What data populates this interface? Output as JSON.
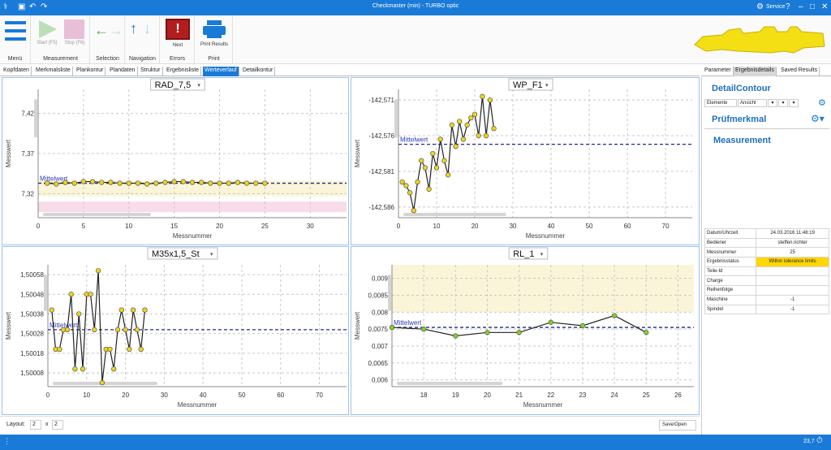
{
  "window": {
    "title": "Checkmaster (min) - TURBO optic",
    "user": "Service"
  },
  "ribbon": {
    "menu_label": "Menü",
    "start_label": "Start (F5)",
    "stop_label": "Stop (F6)",
    "measurement_group": "Measurement",
    "selection_group": "Selection",
    "navigation_group": "Navigation",
    "next_label": "Next",
    "errors_group": "Errors",
    "print_label": "Print Results",
    "print_group": "Print"
  },
  "tabs": [
    "Kopfdaten",
    "Merkmalsliste",
    "Plankontur",
    "Plandaten",
    "Struktur",
    "Ergebnisliste",
    "Werteverlauf",
    "Detailkontur"
  ],
  "right_tabs": [
    "Parameter",
    "Ergebnisdetails",
    "Saved Results"
  ],
  "detail": {
    "contour_title": "DetailContour",
    "toolbar": [
      "Elemente",
      "Ansicht"
    ],
    "pruefmerkmal_title": "Prüfmerkmal",
    "measurement_title": "Measurement",
    "rows": [
      {
        "label": "Datum/Uhrzeit",
        "value": "24.03.2016 11:48:19"
      },
      {
        "label": "Bediener",
        "value": "steffen.richter"
      },
      {
        "label": "Messnummer",
        "value": "25"
      },
      {
        "label": "Ergebnisstatus",
        "value": "Within tolerance limits"
      },
      {
        "label": "Teile-Id",
        "value": ""
      },
      {
        "label": "Charge",
        "value": ""
      },
      {
        "label": "Reihenfolge",
        "value": ""
      },
      {
        "label": "Maschine",
        "value": "-1"
      },
      {
        "label": "Spindel",
        "value": "-1"
      }
    ]
  },
  "bottom": {
    "layout_label": "Layout:",
    "rows": "2",
    "x": "x",
    "cols": "2",
    "save_open": "Save/Open"
  },
  "status": {
    "value": "23,7"
  },
  "colors": {
    "accent": "#1a7ad8",
    "point": "#f2d418",
    "point_green": "#7ed321",
    "mean_line": "#1f2a8c",
    "status_ok": "#ffd700",
    "tol_yellow": "#faf5d8",
    "tol_pink": "#f8dcea"
  },
  "chart_data": [
    {
      "type": "line",
      "title": "RAD_7,5",
      "xlabel": "Messnummer",
      "ylabel": "Messwert",
      "mean_label": "Mittelwert",
      "xlim": [
        0,
        34
      ],
      "ylim": [
        7.29,
        7.45
      ],
      "xticks": [
        0,
        5,
        10,
        15,
        20,
        25,
        30
      ],
      "yticks": [
        7.32,
        7.37,
        7.42
      ],
      "ytick_labels": [
        "7,32",
        "7,37",
        "7,42"
      ],
      "mean": 7.333,
      "bands": [
        {
          "from": 7.317,
          "to": 7.336,
          "color": "tol_yellow"
        },
        {
          "from": 7.297,
          "to": 7.31,
          "color": "tol_pink"
        }
      ],
      "x": [
        1,
        2,
        3,
        4,
        5,
        6,
        7,
        8,
        9,
        10,
        11,
        12,
        13,
        14,
        15,
        16,
        17,
        18,
        19,
        20,
        21,
        22,
        23,
        24,
        25
      ],
      "y": [
        7.333,
        7.332,
        7.334,
        7.333,
        7.335,
        7.335,
        7.334,
        7.334,
        7.333,
        7.333,
        7.333,
        7.332,
        7.333,
        7.334,
        7.335,
        7.335,
        7.334,
        7.334,
        7.333,
        7.333,
        7.333,
        7.334,
        7.333,
        7.333,
        7.333
      ]
    },
    {
      "type": "line",
      "title": "WP_F1",
      "xlabel": "Messnummer",
      "ylabel": "Messwert",
      "mean_label": "Mittelwert",
      "xlim": [
        0,
        77
      ],
      "ylim": [
        -142.5875,
        -142.5695
      ],
      "xticks": [
        0,
        10,
        20,
        30,
        40,
        50,
        60,
        70
      ],
      "yticks": [
        -142.586,
        -142.581,
        -142.576,
        -142.571
      ],
      "ytick_labels": [
        "-142,586",
        "-142,581",
        "-142,576",
        "-142,571"
      ],
      "mean": -142.5772,
      "x": [
        1,
        2,
        3,
        4,
        5,
        6,
        7,
        8,
        9,
        10,
        11,
        12,
        13,
        14,
        15,
        16,
        17,
        18,
        19,
        20,
        21,
        22,
        23,
        24,
        25
      ],
      "y": [
        -142.5825,
        -142.583,
        -142.584,
        -142.5865,
        -142.5825,
        -142.5795,
        -142.5805,
        -142.5835,
        -142.5785,
        -142.5805,
        -142.5765,
        -142.5795,
        -142.5815,
        -142.5745,
        -142.5775,
        -142.574,
        -142.5765,
        -142.5745,
        -142.5735,
        -142.573,
        -142.576,
        -142.5705,
        -142.576,
        -142.571,
        -142.575
      ]
    },
    {
      "type": "line",
      "title": "M35x1,5_St",
      "xlabel": "Messnummer",
      "ylabel": "Messwert",
      "mean_label": "Mittelwert",
      "xlim": [
        0,
        77
      ],
      "ylim": [
        1.50001,
        1.50063
      ],
      "xticks": [
        0,
        10,
        20,
        30,
        40,
        50,
        60,
        70
      ],
      "yticks": [
        1.50008,
        1.50018,
        1.50028,
        1.50038,
        1.50048,
        1.50058
      ],
      "ytick_labels": [
        "1,50008",
        "1,50018",
        "1,50028",
        "1,50038",
        "1,50048",
        "1,50058"
      ],
      "mean": 1.5003,
      "x": [
        1,
        2,
        3,
        4,
        5,
        6,
        7,
        8,
        9,
        10,
        11,
        12,
        13,
        14,
        15,
        16,
        17,
        18,
        19,
        20,
        21,
        22,
        23,
        24,
        25
      ],
      "y": [
        1.5004,
        1.5002,
        1.5002,
        1.5003,
        1.5003,
        1.50048,
        1.5001,
        1.50038,
        1.5001,
        1.50048,
        1.50048,
        1.5003,
        1.5006,
        1.50003,
        1.5002,
        1.5002,
        1.5001,
        1.5003,
        1.5004,
        1.5003,
        1.5002,
        1.5004,
        1.5003,
        1.5002,
        1.5004
      ]
    },
    {
      "type": "line",
      "title": "RL_1",
      "xlabel": "Messnummer",
      "ylabel": "Messwert",
      "mean_label": "Mittelwert",
      "xlim": [
        17,
        26.5
      ],
      "ylim": [
        0.0058,
        0.0094
      ],
      "xticks": [
        18,
        19,
        20,
        21,
        22,
        23,
        24,
        25,
        26
      ],
      "yticks": [
        0.006,
        0.0065,
        0.007,
        0.0075,
        0.008,
        0.0085,
        0.009
      ],
      "ytick_labels": [
        "0,006",
        "0,0065",
        "0,007",
        "0,0075",
        "0,008",
        "0,0085",
        "0,009"
      ],
      "mean": 0.00755,
      "bands": [
        {
          "from": 0.008,
          "to": 0.0094,
          "color": "tol_yellow"
        }
      ],
      "x": [
        17,
        18,
        19,
        20,
        21,
        22,
        23,
        24,
        25
      ],
      "y": [
        0.00755,
        0.0075,
        0.0073,
        0.0074,
        0.0074,
        0.0077,
        0.0076,
        0.0079,
        0.0074
      ]
    }
  ]
}
